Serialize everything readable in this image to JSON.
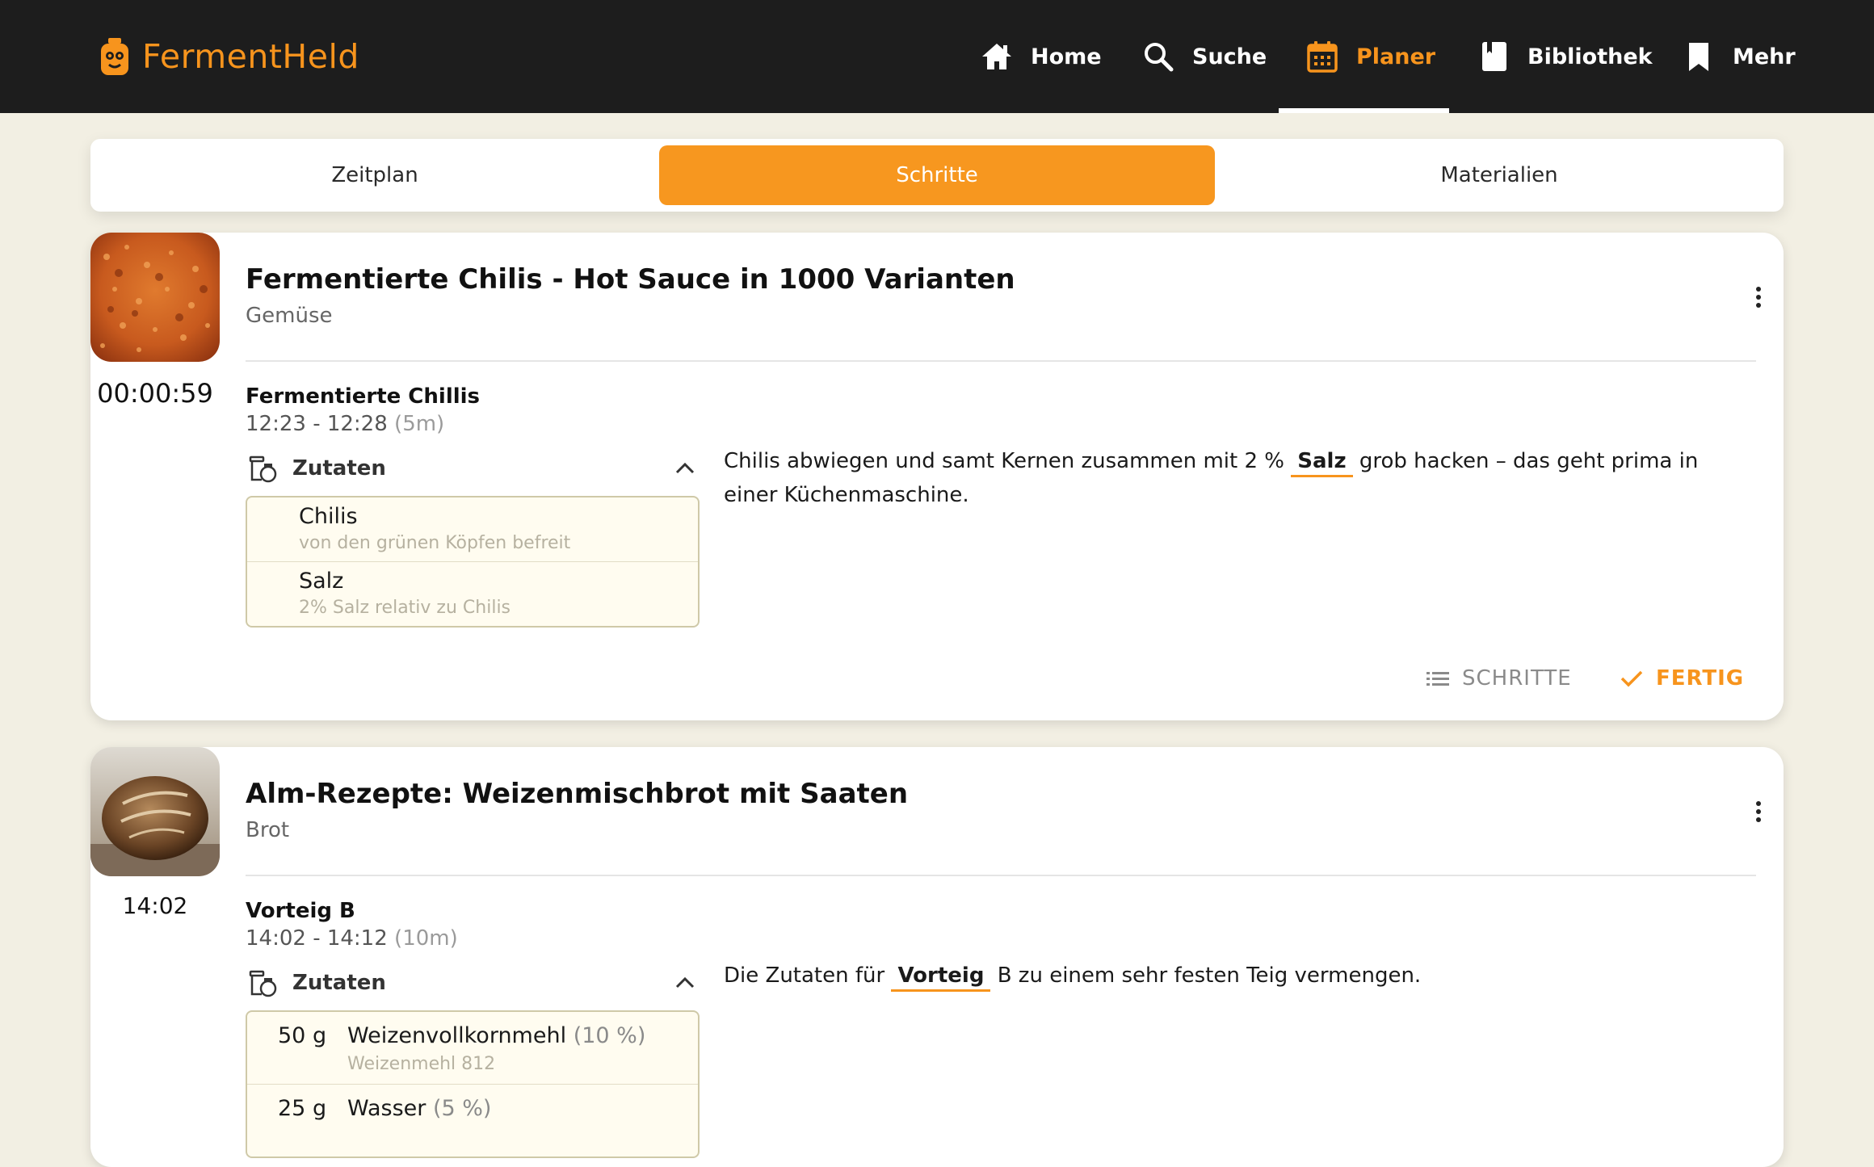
{
  "app": {
    "name": "FermentHeld",
    "brand_color": "#f7941d"
  },
  "nav": {
    "items": [
      {
        "label": "Home",
        "icon": "home-icon"
      },
      {
        "label": "Suche",
        "icon": "search-icon"
      },
      {
        "label": "Planer",
        "icon": "calendar-icon",
        "active": true
      },
      {
        "label": "Bibliothek",
        "icon": "book-icon"
      },
      {
        "label": "Mehr",
        "icon": "bookmark-icon"
      }
    ]
  },
  "tabs": [
    {
      "label": "Zeitplan"
    },
    {
      "label": "Schritte",
      "active": true
    },
    {
      "label": "Materialien"
    }
  ],
  "cards": [
    {
      "timer": "00:00:59",
      "title": "Fermentierte Chilis - Hot Sauce in 1000 Varianten",
      "category": "Gemüse",
      "step_name": "Fermentierte Chillis",
      "step_time": "12:23 - 12:28",
      "step_duration": "(5m)",
      "ingredients_label": "Zutaten",
      "ingredients": [
        {
          "name": "Chilis",
          "note": "von den grünen Köpfen befreit"
        },
        {
          "name": "Salz",
          "note": "2% Salz relativ zu Chilis"
        }
      ],
      "instruction_before": "Chilis abwiegen und samt Kernen zusammen mit 2 % ",
      "instruction_highlight": "Salz",
      "instruction_after": " grob hacken – das geht prima in einer Küchenmaschine.",
      "steps_button": "SCHRITTE",
      "done_button": "FERTIG"
    },
    {
      "timer": "14:02",
      "title": "Alm-Rezepte: Weizenmischbrot mit Saaten",
      "category": "Brot",
      "step_name": "Vorteig B",
      "step_time": "14:02 - 14:12",
      "step_duration": "(10m)",
      "ingredients_label": "Zutaten",
      "ingredients": [
        {
          "qty": "50 g",
          "name": "Weizenvollkornmehl",
          "pct": "(10 %)",
          "note": "Weizenmehl 812"
        },
        {
          "qty": "25 g",
          "name": "Wasser",
          "pct": "(5 %)",
          "note": ""
        }
      ],
      "instruction_before": "Die Zutaten für ",
      "instruction_highlight": "Vorteig",
      "instruction_after": " B zu einem sehr festen Teig vermengen."
    }
  ]
}
